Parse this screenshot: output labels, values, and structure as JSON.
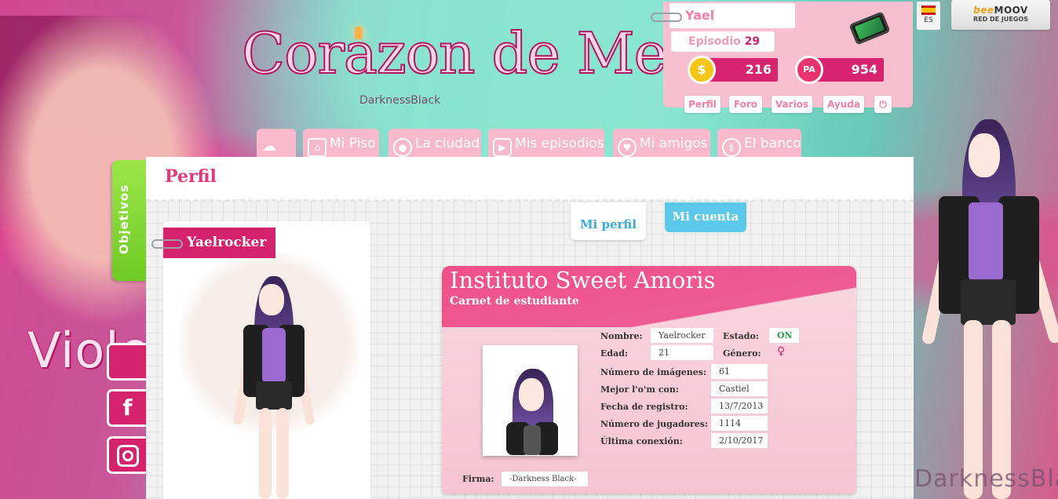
{
  "background_art": {
    "left_name": "Violet",
    "watermark": "DarknessBlack"
  },
  "logo": {
    "title": "Corazon de Melón",
    "subtitle": "DarknessBlack"
  },
  "user_panel": {
    "username": "Yael",
    "episode_label": "Episodio",
    "episode_number": "29",
    "coins_value": "216",
    "coins_icon": "$",
    "pa_value": "954",
    "pa_icon": "PA",
    "buttons": [
      {
        "label": "Perfil"
      },
      {
        "label": "Foro"
      },
      {
        "label": "Varios"
      },
      {
        "label": "Ayuda"
      }
    ],
    "logout_icon": "⏻"
  },
  "language": {
    "code": "ES"
  },
  "network": {
    "brand_prefix": "bee",
    "brand": "MOOV",
    "subtitle": "RED DE JUEGOS"
  },
  "nav": {
    "items": [
      {
        "label": ""
      },
      {
        "label": "Mi Piso"
      },
      {
        "label": "La ciudad"
      },
      {
        "label": "Mis episodios"
      },
      {
        "label": "Mi amigos"
      },
      {
        "label": "El banco"
      }
    ]
  },
  "side": {
    "objetivos": "Objetivos",
    "facebook": "f"
  },
  "page": {
    "title": "Perfil",
    "tabs": {
      "mi_perfil": "Mi perfil",
      "mi_cuenta": "Mi cuenta"
    }
  },
  "avatar": {
    "name": "Yaelrocker"
  },
  "student_card": {
    "title": "Instituto Sweet Amoris",
    "subtitle": "Carnet de estudiante",
    "fields": {
      "nombre_label": "Nombre:",
      "nombre": "Yaelrocker",
      "estado_label": "Estado:",
      "estado": "ON",
      "edad_label": "Edad:",
      "edad": "21",
      "genero_label": "Género:",
      "genero": "♀",
      "imagenes_label": "Número de imágenes:",
      "imagenes": "61",
      "mejor_label": "Mejor l'o'm con:",
      "mejor": "Castiel",
      "registro_label": "Fecha de registro:",
      "registro": "13/7/2013",
      "jugadores_label": "Número de jugadores:",
      "jugadores": "1114",
      "conexion_label": "Última conexión:",
      "conexion": "2/10/2017",
      "firma_label": "Firma:",
      "firma": "-Darkness Black-"
    }
  },
  "colors": {
    "accent_pink": "#d4226d",
    "light_pink": "#f7bfcf",
    "green_tab": "#7ad02e",
    "blue_tab": "#5cc8ea",
    "title_pink": "#e03a7b"
  }
}
